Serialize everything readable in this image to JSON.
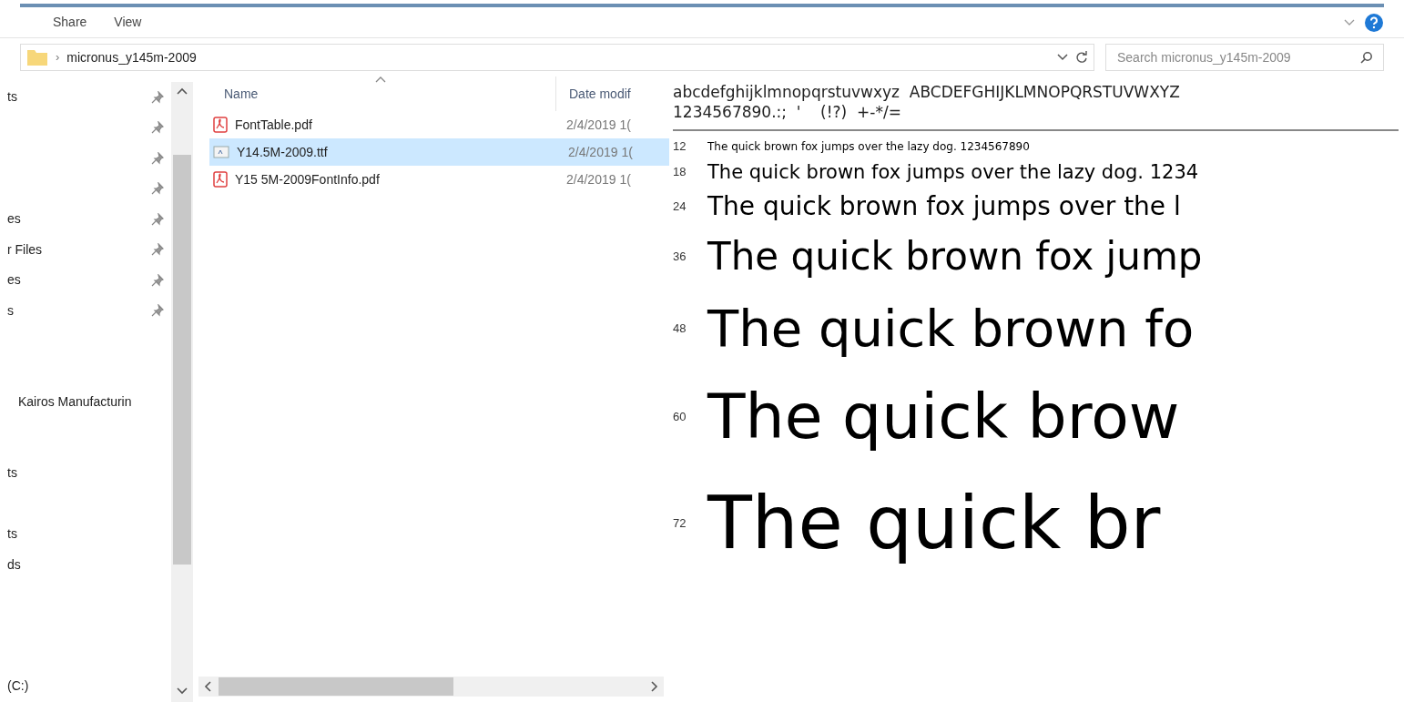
{
  "ribbon": {
    "tabs": [
      {
        "label": "Share",
        "selected": false
      },
      {
        "label": "View",
        "selected": false
      }
    ]
  },
  "address_bar": {
    "separator": "›",
    "path": "micronus_y145m-2009"
  },
  "search": {
    "placeholder": "Search micronus_y145m-2009"
  },
  "nav_pane": {
    "items": [
      {
        "label": "ts",
        "pinned": true
      },
      {
        "pinned": true
      },
      {
        "pinned": true
      },
      {
        "pinned": true
      },
      {
        "label": "es",
        "pinned": true
      },
      {
        "label": "r Files",
        "pinned": true
      },
      {
        "label": "es",
        "pinned": true
      },
      {
        "label": "s",
        "pinned": true
      },
      {
        "label": "Kairos Manufacturin",
        "pinned": false
      },
      {
        "label": "ts",
        "pinned": false
      },
      {
        "label": "ts",
        "pinned": false
      },
      {
        "label": "ds",
        "pinned": false
      },
      {
        "label": "(C:)",
        "pinned": false
      }
    ]
  },
  "file_list": {
    "columns": [
      "Name",
      "Date modif"
    ],
    "rows": [
      {
        "name": "FontTable.pdf",
        "kind": "pdf",
        "date": "2/4/2019 1(",
        "selected": false
      },
      {
        "name": "Y14.5M-2009.ttf",
        "kind": "font",
        "date": "2/4/2019 1(",
        "selected": true
      },
      {
        "name": "Y15 5M-2009FontInfo.pdf",
        "kind": "pdf",
        "date": "2/4/2019 1(",
        "selected": false
      }
    ]
  },
  "preview": {
    "charset": [
      "abcdefghijklmnopqrstuvwxyz  ABCDEFGHIJKLMNOPQRSTUVWXYZ",
      "1234567890.:;  '    (!?)  +-*/="
    ],
    "samples": [
      {
        "size": "12",
        "text": "The quick brown fox jumps over the lazy dog. 1234567890"
      },
      {
        "size": "18",
        "text": "The quick brown fox jumps over the lazy dog. 1234"
      },
      {
        "size": "24",
        "text": "The quick brown fox jumps over the l"
      },
      {
        "size": "36",
        "text": "The quick brown fox jump"
      },
      {
        "size": "48",
        "text": "The quick brown fo"
      },
      {
        "size": "60",
        "text": "The quick brow"
      },
      {
        "size": "72",
        "text": "The quick br"
      }
    ]
  }
}
